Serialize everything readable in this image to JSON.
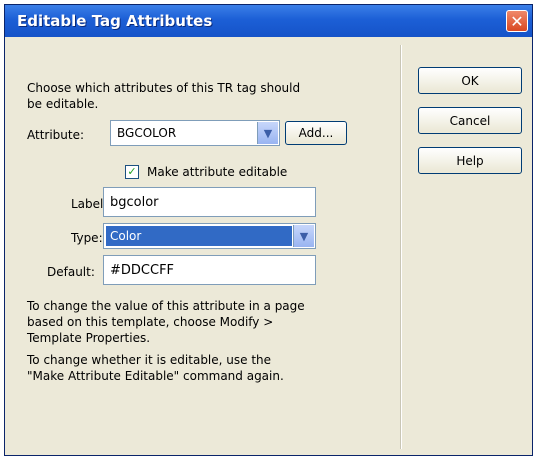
{
  "window": {
    "title": "Editable Tag Attributes",
    "close_icon": "close-icon"
  },
  "intro": {
    "line1": "Choose which attributes of this TR tag should",
    "line2": "be editable."
  },
  "attribute": {
    "label": "Attribute:",
    "value": "BGCOLOR",
    "add_button": "Add..."
  },
  "editable_checkbox": {
    "label": "Make attribute editable",
    "checked": true
  },
  "label_field": {
    "label": "Label:",
    "value": "bgcolor"
  },
  "type_field": {
    "label": "Type:",
    "value": "Color"
  },
  "default_field": {
    "label": "Default:",
    "value": "#DDCCFF"
  },
  "notes": {
    "p1_line1": "To change the value of this attribute in a page",
    "p1_line2": "based on this template, choose Modify >",
    "p1_line3": "Template Properties.",
    "p2_line1": "To change whether it is editable, use the",
    "p2_line2": "\"Make Attribute Editable\" command again."
  },
  "buttons": {
    "ok": "OK",
    "cancel": "Cancel",
    "help": "Help"
  },
  "colors": {
    "titlebar": "#1c5fd6",
    "selection": "#316ac5",
    "dialog_bg": "#ece9d8"
  }
}
